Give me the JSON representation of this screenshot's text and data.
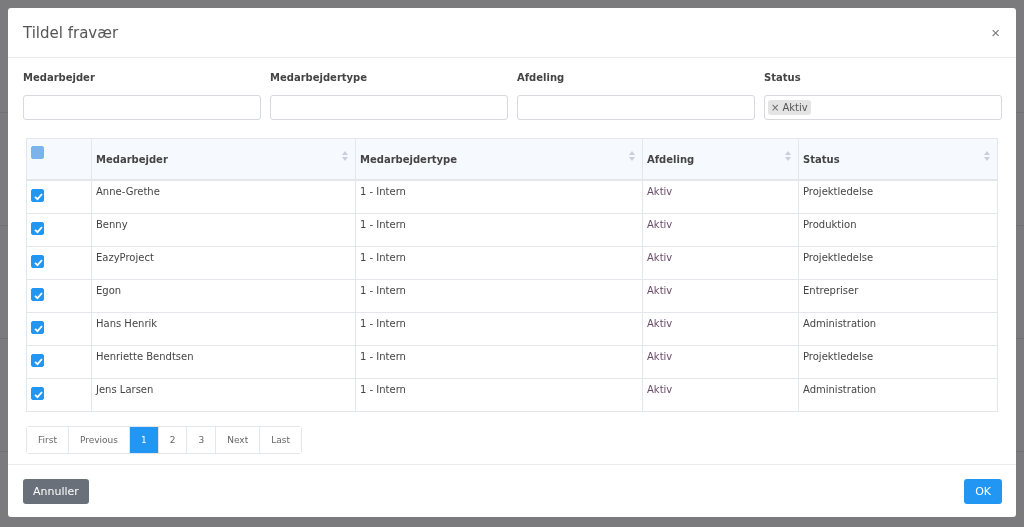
{
  "dialog": {
    "title": "Tildel fravær",
    "close": "×"
  },
  "filters": [
    {
      "label": "Medarbejder",
      "kind": "text"
    },
    {
      "label": "Medarbejdertype",
      "kind": "text"
    },
    {
      "label": "Afdeling",
      "kind": "text"
    },
    {
      "label": "Status",
      "kind": "tags",
      "tags": [
        {
          "remove": "×",
          "label": "Aktiv"
        }
      ]
    }
  ],
  "table": {
    "select_all": {
      "checked": false
    },
    "columns": [
      "Medarbejder",
      "Medarbejdertype",
      "Afdeling",
      "Status"
    ],
    "rows": [
      {
        "checked": true,
        "cells": [
          "Anne-Grethe",
          "1 - Intern",
          "Aktiv",
          "Projektledelse"
        ]
      },
      {
        "checked": true,
        "cells": [
          "Benny",
          "1 - Intern",
          "Aktiv",
          "Produktion"
        ]
      },
      {
        "checked": true,
        "cells": [
          "EazyProject",
          "1 - Intern",
          "Aktiv",
          "Projektledelse"
        ]
      },
      {
        "checked": true,
        "cells": [
          "Egon",
          "1 - Intern",
          "Aktiv",
          "Entrepriser"
        ]
      },
      {
        "checked": true,
        "cells": [
          "Hans Henrik",
          "1 - Intern",
          "Aktiv",
          "Administration"
        ]
      },
      {
        "checked": true,
        "cells": [
          "Henriette Bendtsen",
          "1 - Intern",
          "Aktiv",
          "Projektledelse"
        ]
      },
      {
        "checked": true,
        "cells": [
          "Jens Larsen",
          "1 - Intern",
          "Aktiv",
          "Administration"
        ]
      }
    ]
  },
  "pagination": [
    {
      "label": "First",
      "selected": false
    },
    {
      "label": "Previous",
      "selected": false
    },
    {
      "label": "1",
      "selected": true
    },
    {
      "label": "2",
      "selected": false
    },
    {
      "label": "3",
      "selected": false
    },
    {
      "label": "Next",
      "selected": false
    },
    {
      "label": "Last",
      "selected": false
    }
  ],
  "footer": {
    "cancel": "Annuller",
    "ok": "OK"
  }
}
